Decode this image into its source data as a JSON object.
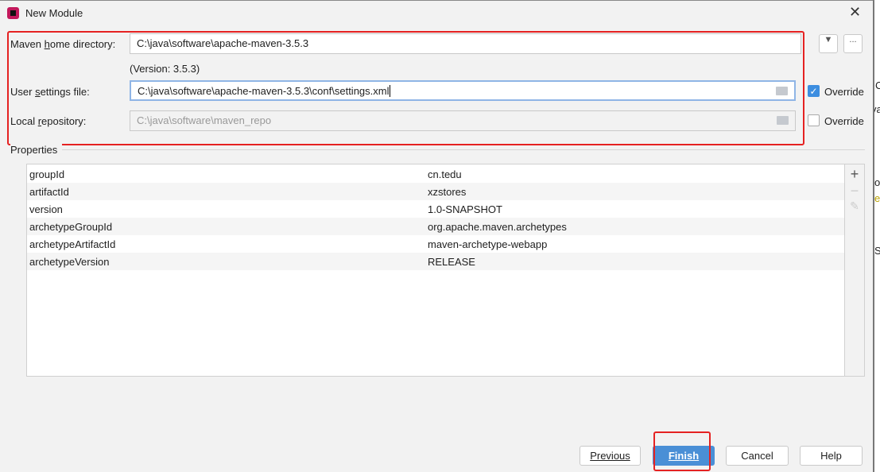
{
  "window": {
    "title": "New Module"
  },
  "form": {
    "maven_home_label": "Maven home directory:",
    "maven_home_value": "C:\\java\\software\\apache-maven-3.5.3",
    "version_text": "(Version: 3.5.3)",
    "user_settings_label": "User settings file:",
    "user_settings_value": "C:\\java\\software\\apache-maven-3.5.3\\conf\\settings.xml",
    "user_settings_override": {
      "label": "Override",
      "checked": true
    },
    "local_repo_label": "Local repository:",
    "local_repo_value": "C:\\java\\software\\maven_repo",
    "local_repo_override": {
      "label": "Override",
      "checked": false
    },
    "browse_label": "..."
  },
  "properties": {
    "title": "Properties",
    "rows": [
      {
        "key": "groupId",
        "value": "cn.tedu"
      },
      {
        "key": "artifactId",
        "value": "xzstores"
      },
      {
        "key": "version",
        "value": "1.0-SNAPSHOT"
      },
      {
        "key": "archetypeGroupId",
        "value": "org.apache.maven.archetypes"
      },
      {
        "key": "archetypeArtifactId",
        "value": "maven-archetype-webapp"
      },
      {
        "key": "archetypeVersion",
        "value": "RELEASE"
      }
    ]
  },
  "buttons": {
    "previous": "Previous",
    "finish": "Finish",
    "cancel": "Cancel",
    "help": "Help"
  },
  "background_fragments": [
    "C",
    "va",
    "o",
    "e",
    "S"
  ],
  "colors": {
    "accent": "#4a8fd6",
    "highlight": "#e52222"
  }
}
